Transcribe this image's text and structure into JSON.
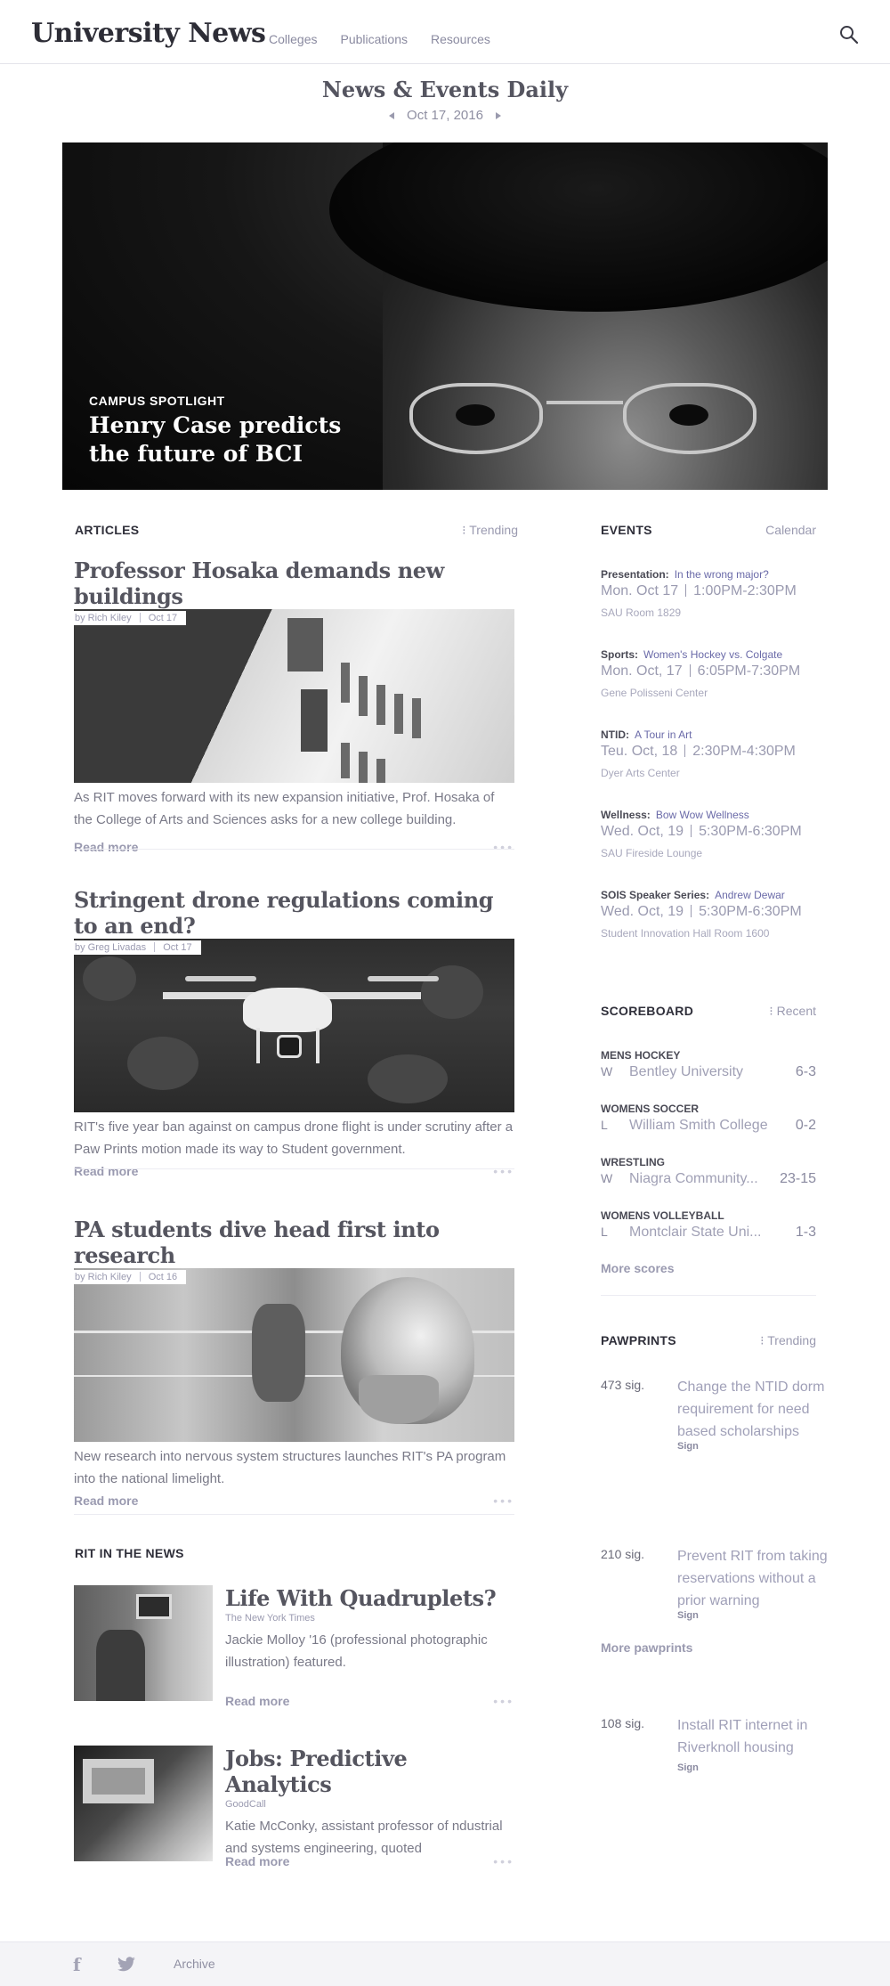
{
  "header": {
    "brand": "University News",
    "nav": [
      "Colleges",
      "Publications",
      "Resources"
    ]
  },
  "edition": {
    "title": "News & Events Daily",
    "date": "Oct 17, 2016"
  },
  "hero": {
    "kicker": "CAMPUS SPOTLIGHT",
    "title": "Henry Case predicts the future of BCI"
  },
  "articles": {
    "label": "ARTICLES",
    "trending": "Trending",
    "read_more": "Read more",
    "items": [
      {
        "title": "Professor Hosaka demands new buildings",
        "author": "by Rich Kiley",
        "date": "Oct 17",
        "text": "As RIT moves forward with its new expansion initiative, Prof. Hosaka of the College of Arts and Sciences asks for a new college building."
      },
      {
        "title": "Stringent drone regulations coming to an end?",
        "author": "by Greg Livadas",
        "date": "Oct 17",
        "text": "RIT's five year ban against on campus drone flight is under scrutiny after a Paw Prints motion made its way to Student government."
      },
      {
        "title": "PA students dive head first into research",
        "author": "by Rich Kiley",
        "date": "Oct 16",
        "text": "New research into nervous system structures launches RIT's PA program into the national limelight."
      }
    ]
  },
  "rit_news": {
    "label": "RIT IN THE NEWS",
    "read_more": "Read more",
    "items": [
      {
        "title": "Life With Quadruplets?",
        "source": "The New York Times",
        "text": "Jackie Molloy '16 (professional photographic illustration) featured."
      },
      {
        "title": "Jobs: Predictive Analytics",
        "source": "GoodCall",
        "text": "Katie McConky, assistant professor of ndustrial and systems engineering, quoted"
      }
    ]
  },
  "events": {
    "label": "EVENTS",
    "calendar": "Calendar",
    "items": [
      {
        "category": "Presentation:",
        "name": "In the wrong major?",
        "date": "Mon. Oct 17",
        "time": "1:00PM-2:30PM",
        "place": "SAU Room 1829"
      },
      {
        "category": "Sports:",
        "name": "Women's Hockey vs. Colgate",
        "date": "Mon. Oct, 17",
        "time": "6:05PM-7:30PM",
        "place": "Gene Polisseni Center"
      },
      {
        "category": "NTID:",
        "name": "A Tour in Art",
        "date": "Teu. Oct, 18",
        "time": "2:30PM-4:30PM",
        "place": "Dyer Arts Center"
      },
      {
        "category": "Wellness:",
        "name": "Bow Wow Wellness",
        "date": "Wed. Oct, 19",
        "time": "5:30PM-6:30PM",
        "place": "SAU Fireside Lounge"
      },
      {
        "category": "SOIS Speaker Series:",
        "name": "Andrew Dewar",
        "date": "Wed. Oct, 19",
        "time": "5:30PM-6:30PM",
        "place": "Student Innovation Hall Room 1600"
      }
    ]
  },
  "scoreboard": {
    "label": "SCOREBOARD",
    "recent": "Recent",
    "more": "More scores",
    "items": [
      {
        "sport": "MENS HOCKEY",
        "result": "W",
        "opponent": "Bentley University",
        "score": "6-3"
      },
      {
        "sport": "WOMENS SOCCER",
        "result": "L",
        "opponent": "William Smith College",
        "score": "0-2"
      },
      {
        "sport": "WRESTLING",
        "result": "W",
        "opponent": "Niagra Community...",
        "score": "23-15"
      },
      {
        "sport": "WOMENS VOLLEYBALL",
        "result": "L",
        "opponent": "Montclair State Uni...",
        "score": "1-3"
      }
    ]
  },
  "pawprints": {
    "label": "PAWPRINTS",
    "trending": "Trending",
    "more": "More pawprints",
    "items": [
      {
        "count": "473 sig.",
        "text": "Change the NTID dorm requirement for need based scholarships",
        "sign": "Sign"
      },
      {
        "count": "210 sig.",
        "text": "Prevent RIT from taking reservations without a prior warning",
        "sign": "Sign"
      },
      {
        "count": "108 sig.",
        "text": "Install RIT internet in Riverknoll housing",
        "sign": "Sign"
      }
    ]
  },
  "footer": {
    "facebook_icon": "f",
    "archive": "Archive"
  },
  "colors": {
    "accent_link": "#6a6aa8",
    "muted_text": "#9a9ab0",
    "footer_bg": "#f4f4f7"
  }
}
